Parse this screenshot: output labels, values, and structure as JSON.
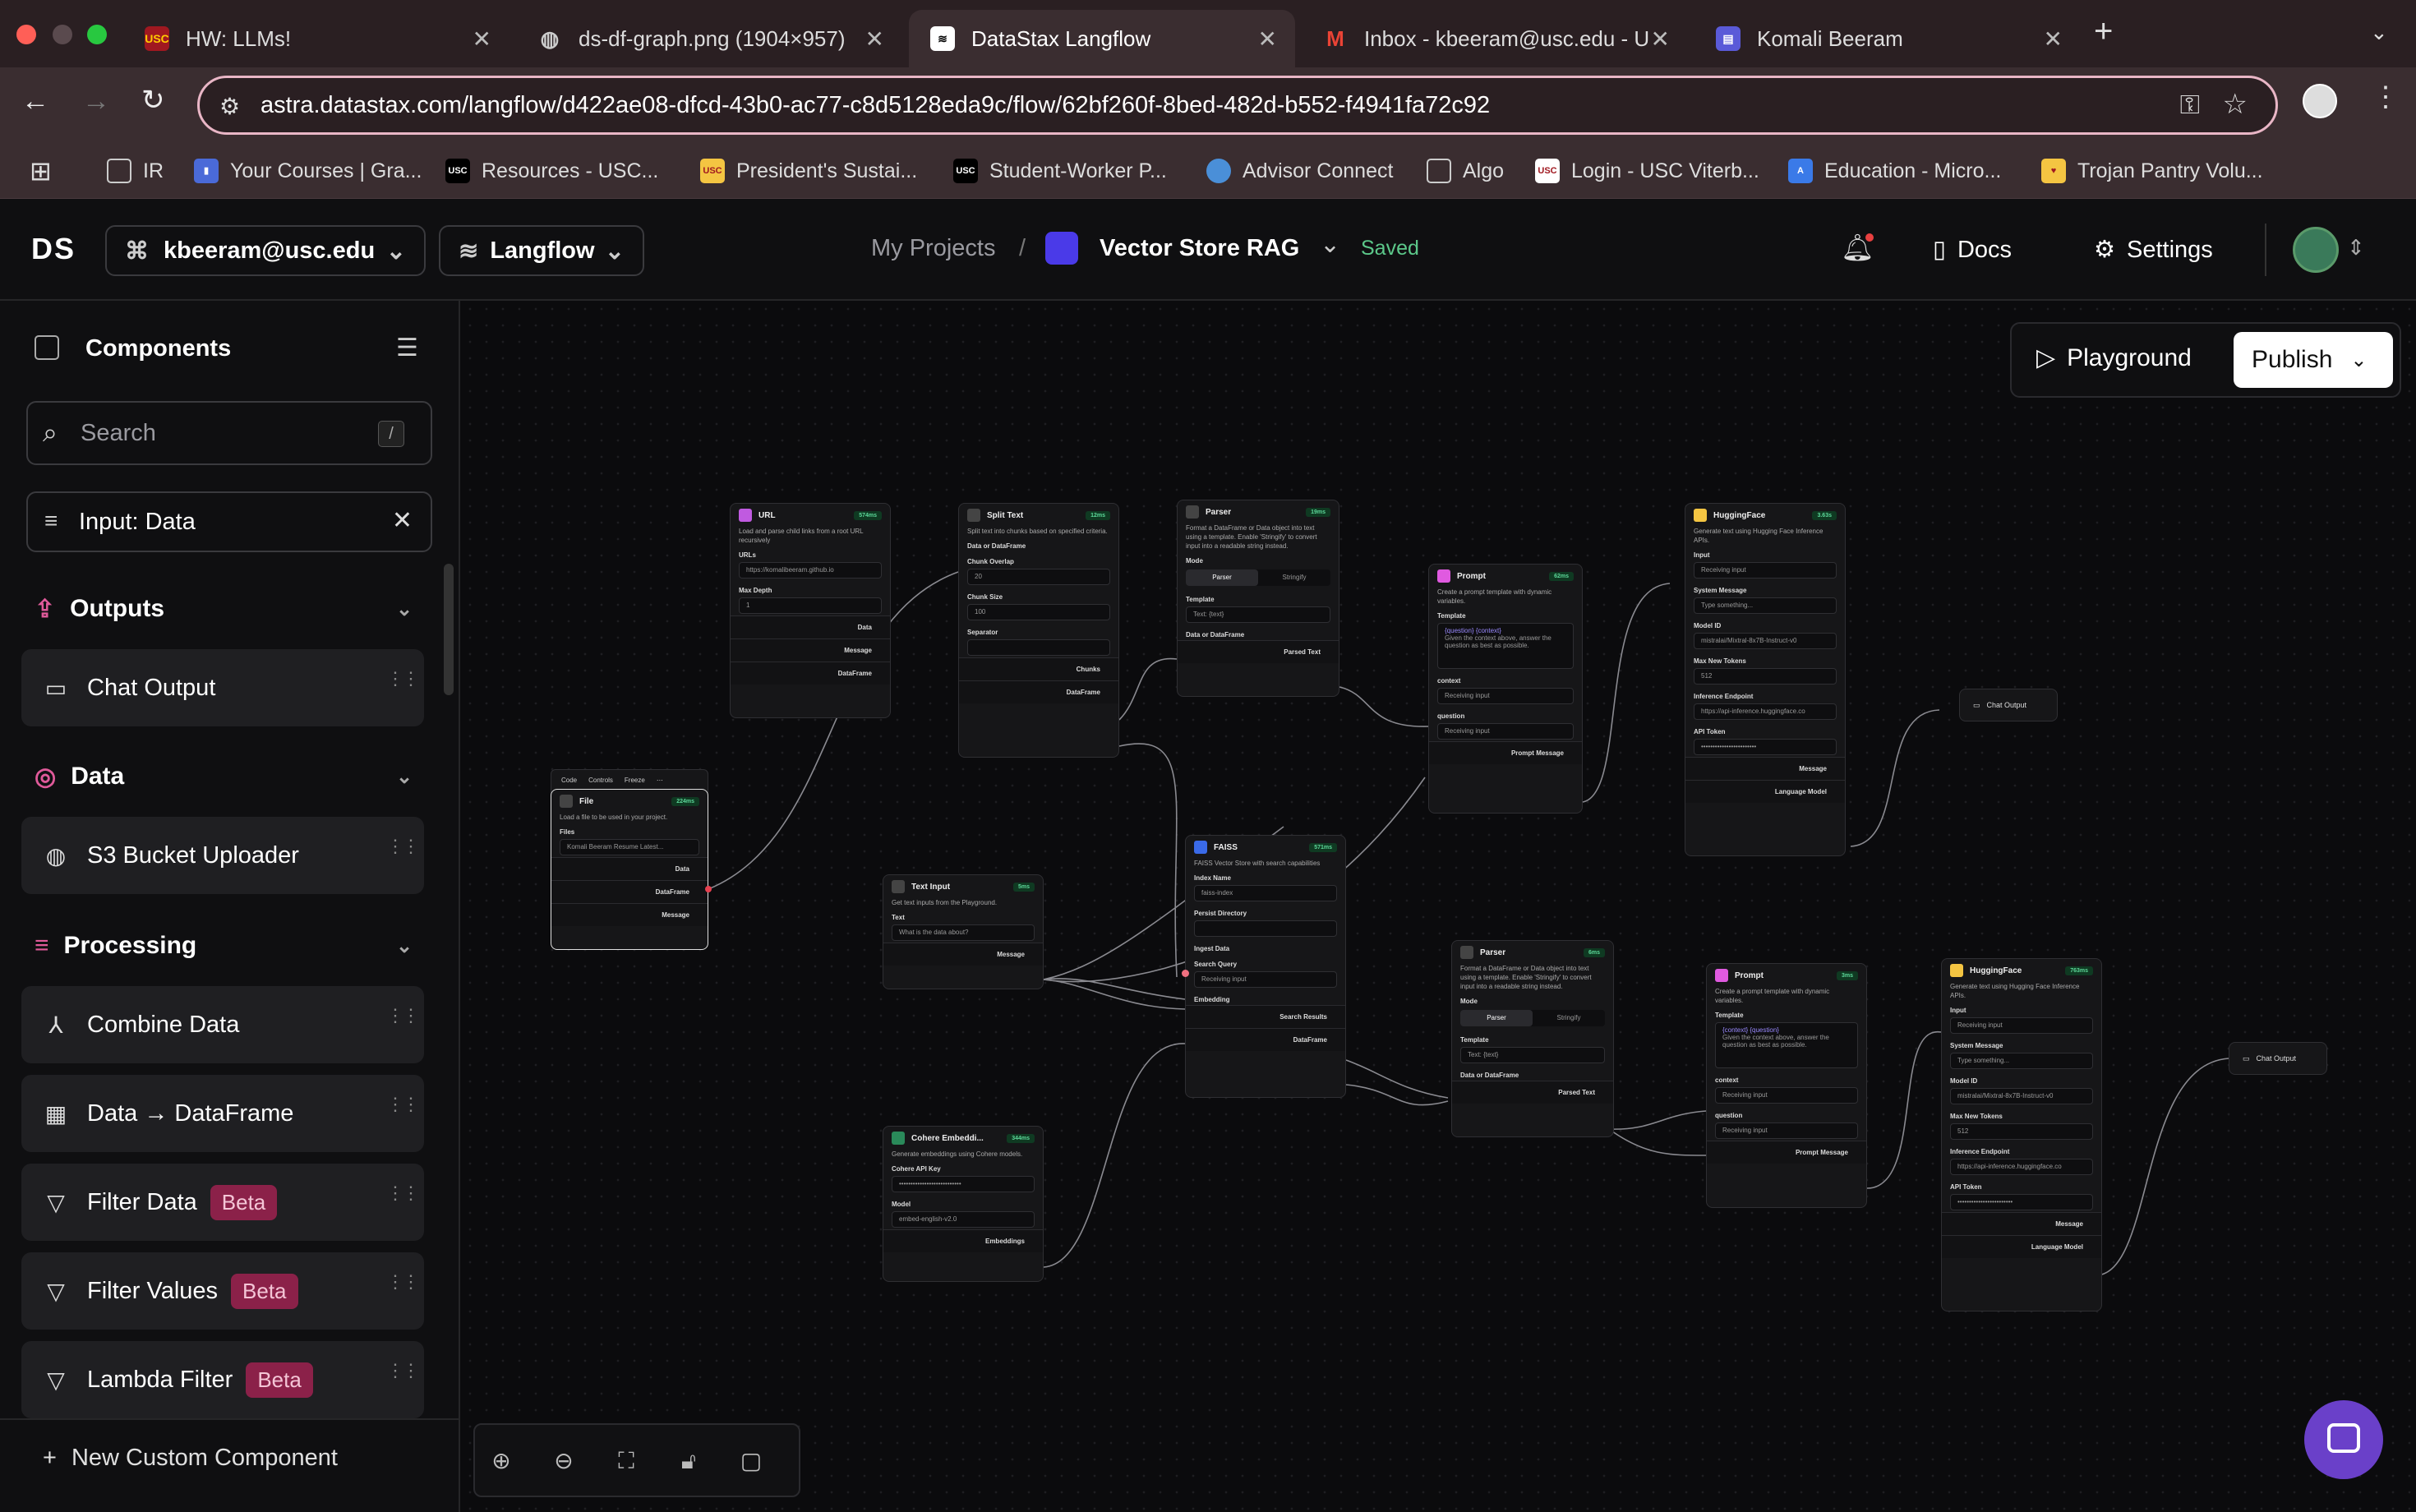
{
  "browser": {
    "tabs": [
      {
        "title": "HW: LLMs!",
        "favicon": "usc-logo-icon"
      },
      {
        "title": "ds-df-graph.png (1904×957)",
        "favicon": "globe-icon"
      },
      {
        "title": "DataStax Langflow",
        "favicon": "langflow-icon"
      },
      {
        "title": "Inbox - kbeeram@usc.edu - U",
        "favicon": "gmail-icon"
      },
      {
        "title": "Komali Beeram",
        "favicon": "site-icon"
      }
    ],
    "url": "astra.datastax.com/langflow/d422ae08-dfcd-43b0-ac77-c8d5128eda9c/flow/62bf260f-8bed-482d-b552-f4941fa72c92",
    "bookmarks": [
      "IR",
      "Your Courses | Gra...",
      "Resources - USC...",
      "President's Sustai...",
      "Student-Worker P...",
      "Advisor Connect",
      "Algo",
      "Login - USC Viterb...",
      "Education - Micro...",
      "Trojan Pantry Volu..."
    ]
  },
  "appbar": {
    "logo": "DS",
    "org": "kbeeram@usc.edu",
    "product": "Langflow",
    "breadcrumb_root": "My Projects",
    "separator": "/",
    "flow_name": "Vector Store RAG",
    "save_status": "Saved",
    "docs": "Docs",
    "settings": "Settings"
  },
  "sidebar": {
    "title": "Components",
    "search_placeholder": "Search",
    "search_shortcut": "/",
    "filter": "Input: Data",
    "sections": {
      "outputs": {
        "label": "Outputs",
        "items": [
          {
            "label": "Chat Output"
          }
        ]
      },
      "data": {
        "label": "Data",
        "items": [
          {
            "label": "S3 Bucket Uploader"
          }
        ]
      },
      "processing": {
        "label": "Processing",
        "items": [
          {
            "label": "Combine Data",
            "badge": ""
          },
          {
            "label": "Data → DataFrame",
            "badge": ""
          },
          {
            "label": "Filter Data",
            "badge": "Beta"
          },
          {
            "label": "Filter Values",
            "badge": "Beta"
          },
          {
            "label": "Lambda Filter",
            "badge": "Beta"
          }
        ]
      }
    },
    "new_component": "New Custom Component"
  },
  "canvas": {
    "playground": "Playground",
    "publish": "Publish",
    "nodes": {
      "url": {
        "title": "URL",
        "badge": "574ms",
        "desc": "Load and parse child links from a root URL recursively",
        "urls_label": "URLs",
        "urls_value": "https://komalibeeram.github.io",
        "depth_label": "Max Depth",
        "depth_value": "1",
        "out1": "Data",
        "out2": "Message",
        "out3": "DataFrame"
      },
      "split": {
        "title": "Split Text",
        "badge": "12ms",
        "desc": "Split text into chunks based on specified criteria.",
        "in_label": "Data or DataFrame",
        "overlap_label": "Chunk Overlap",
        "overlap_value": "20",
        "size_label": "Chunk Size",
        "size_value": "100",
        "sep_label": "Separator",
        "out1": "Chunks",
        "out2": "DataFrame"
      },
      "parser1": {
        "title": "Parser",
        "badge": "19ms",
        "desc": "Format a DataFrame or Data object into text using a template. Enable 'Stringify' to convert input into a readable string instead.",
        "mode_label": "Mode",
        "mode_a": "Parser",
        "mode_b": "Stringify",
        "template_label": "Template",
        "template_value": "Text: {text}",
        "in_label": "Data or DataFrame",
        "out": "Parsed Text"
      },
      "prompt1": {
        "title": "Prompt",
        "badge": "62ms",
        "desc": "Create a prompt template with dynamic variables.",
        "template_label": "Template",
        "template_vars": "{question} {context}",
        "template_text": "Given the context above, answer the question as best as possible.",
        "ctx_label": "context",
        "ctx_value": "Receiving input",
        "q_label": "question",
        "q_value": "Receiving input",
        "out": "Prompt Message"
      },
      "hf1": {
        "title": "HuggingFace",
        "badge": "3.63s",
        "desc": "Generate text using Hugging Face Inference APIs.",
        "input_label": "Input",
        "input_value": "Receiving input",
        "sys_label": "System Message",
        "sys_value": "Type something...",
        "model_label": "Model ID",
        "model_value": "mistralai/Mixtral-8x7B-Instruct-v0",
        "tokens_label": "Max New Tokens",
        "tokens_value": "512",
        "endpoint_label": "Inference Endpoint",
        "endpoint_value": "https://api-inference.huggingface.co",
        "token_label": "API Token",
        "token_value": "••••••••••••••••••••••••",
        "out1": "Message",
        "out2": "Language Model"
      },
      "chat1": {
        "title": "Chat Output"
      },
      "file": {
        "toolbar_a": "Code",
        "toolbar_b": "Controls",
        "toolbar_c": "Freeze",
        "title": "File",
        "badge": "224ms",
        "desc": "Load a file to be used in your project.",
        "files_label": "Files",
        "files_value": "Komali Beeram Resume Latest...",
        "out1": "Data",
        "out2": "DataFrame",
        "out3": "Message"
      },
      "textin": {
        "title": "Text Input",
        "badge": "5ms",
        "desc": "Get text inputs from the Playground.",
        "text_label": "Text",
        "text_value": "What is the data about?",
        "out": "Message"
      },
      "faiss": {
        "title": "FAISS",
        "badge": "571ms",
        "desc": "FAISS Vector Store with search capabilities",
        "index_label": "Index Name",
        "index_value": "faiss-index",
        "persist_label": "Persist Directory",
        "ingest_label": "Ingest Data",
        "query_label": "Search Query",
        "query_value": "Receiving input",
        "embed_label": "Embedding",
        "out1": "Search Results",
        "out2": "DataFrame"
      },
      "cohere": {
        "title": "Cohere Embeddi...",
        "badge": "344ms",
        "desc": "Generate embeddings using Cohere models.",
        "key_label": "Cohere API Key",
        "key_value": "•••••••••••••••••••••••••••",
        "model_label": "Model",
        "model_value": "embed-english-v2.0",
        "out": "Embeddings"
      },
      "parser2": {
        "title": "Parser",
        "badge": "6ms",
        "desc": "Format a DataFrame or Data object into text using a template. Enable 'Stringify' to convert input into a readable string instead.",
        "mode_label": "Mode",
        "mode_a": "Parser",
        "mode_b": "Stringify",
        "template_label": "Template",
        "template_value": "Text: {text}",
        "in_label": "Data or DataFrame",
        "out": "Parsed Text"
      },
      "prompt2": {
        "title": "Prompt",
        "badge": "3ms",
        "desc": "Create a prompt template with dynamic variables.",
        "template_label": "Template",
        "template_vars": "{context} {question}",
        "template_text": "Given the context above, answer the question as best as possible.",
        "ctx_label": "context",
        "ctx_value": "Receiving input",
        "q_label": "question",
        "q_value": "Receiving input",
        "out": "Prompt Message"
      },
      "hf2": {
        "title": "HuggingFace",
        "badge": "763ms",
        "desc": "Generate text using Hugging Face Inference APIs.",
        "input_label": "Input",
        "input_value": "Receiving input",
        "sys_label": "System Message",
        "sys_value": "Type something...",
        "model_label": "Model ID",
        "model_value": "mistralai/Mixtral-8x7B-Instruct-v0",
        "tokens_label": "Max New Tokens",
        "tokens_value": "512",
        "endpoint_label": "Inference Endpoint",
        "endpoint_value": "https://api-inference.huggingface.co",
        "token_label": "API Token",
        "token_value": "••••••••••••••••••••••••",
        "out1": "Message",
        "out2": "Language Model"
      },
      "chat2": {
        "title": "Chat Output"
      }
    }
  }
}
